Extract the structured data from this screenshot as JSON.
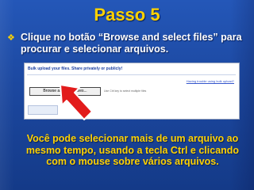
{
  "slide": {
    "title": "Passo 5",
    "bullet": "Clique no botão “Browse and select files” para procurar e selecionar arquivos.",
    "note": "Você pode selecionar mais de um arquivo ao mesmo tempo, usando a tecla Ctrl e clicando com o mouse sobre vários arquivos."
  },
  "screenshot": {
    "heading": "Bulk upload your files. Share privately or publicly!",
    "help_link": "Having trouble using bulk upload?",
    "button_label": "Browse and select files...",
    "hint": "Use Ctrl key to select multiple files"
  },
  "colors": {
    "title": "#ffd200",
    "note": "#ffd200",
    "body_text": "#ffffff",
    "arrow": "#e21b1b",
    "background": "#1c48a0"
  }
}
